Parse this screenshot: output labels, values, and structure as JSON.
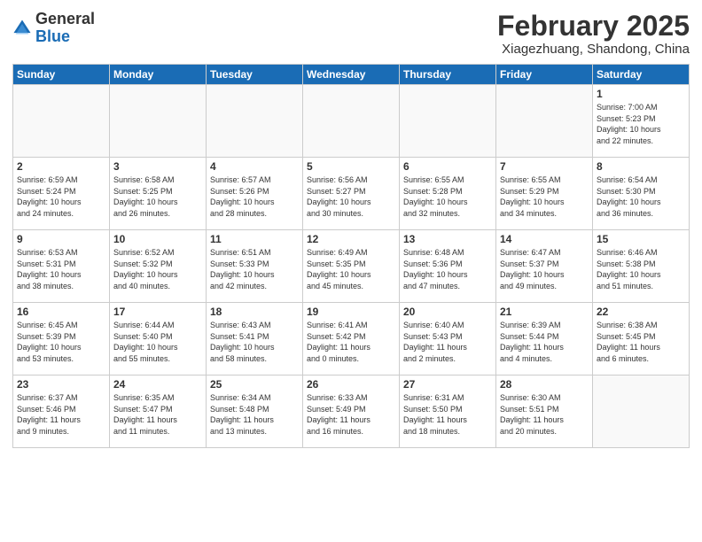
{
  "header": {
    "logo_general": "General",
    "logo_blue": "Blue",
    "month_title": "February 2025",
    "subtitle": "Xiagezhuang, Shandong, China"
  },
  "days_of_week": [
    "Sunday",
    "Monday",
    "Tuesday",
    "Wednesday",
    "Thursday",
    "Friday",
    "Saturday"
  ],
  "weeks": [
    [
      {
        "day": "",
        "info": ""
      },
      {
        "day": "",
        "info": ""
      },
      {
        "day": "",
        "info": ""
      },
      {
        "day": "",
        "info": ""
      },
      {
        "day": "",
        "info": ""
      },
      {
        "day": "",
        "info": ""
      },
      {
        "day": "1",
        "info": "Sunrise: 7:00 AM\nSunset: 5:23 PM\nDaylight: 10 hours\nand 22 minutes."
      }
    ],
    [
      {
        "day": "2",
        "info": "Sunrise: 6:59 AM\nSunset: 5:24 PM\nDaylight: 10 hours\nand 24 minutes."
      },
      {
        "day": "3",
        "info": "Sunrise: 6:58 AM\nSunset: 5:25 PM\nDaylight: 10 hours\nand 26 minutes."
      },
      {
        "day": "4",
        "info": "Sunrise: 6:57 AM\nSunset: 5:26 PM\nDaylight: 10 hours\nand 28 minutes."
      },
      {
        "day": "5",
        "info": "Sunrise: 6:56 AM\nSunset: 5:27 PM\nDaylight: 10 hours\nand 30 minutes."
      },
      {
        "day": "6",
        "info": "Sunrise: 6:55 AM\nSunset: 5:28 PM\nDaylight: 10 hours\nand 32 minutes."
      },
      {
        "day": "7",
        "info": "Sunrise: 6:55 AM\nSunset: 5:29 PM\nDaylight: 10 hours\nand 34 minutes."
      },
      {
        "day": "8",
        "info": "Sunrise: 6:54 AM\nSunset: 5:30 PM\nDaylight: 10 hours\nand 36 minutes."
      }
    ],
    [
      {
        "day": "9",
        "info": "Sunrise: 6:53 AM\nSunset: 5:31 PM\nDaylight: 10 hours\nand 38 minutes."
      },
      {
        "day": "10",
        "info": "Sunrise: 6:52 AM\nSunset: 5:32 PM\nDaylight: 10 hours\nand 40 minutes."
      },
      {
        "day": "11",
        "info": "Sunrise: 6:51 AM\nSunset: 5:33 PM\nDaylight: 10 hours\nand 42 minutes."
      },
      {
        "day": "12",
        "info": "Sunrise: 6:49 AM\nSunset: 5:35 PM\nDaylight: 10 hours\nand 45 minutes."
      },
      {
        "day": "13",
        "info": "Sunrise: 6:48 AM\nSunset: 5:36 PM\nDaylight: 10 hours\nand 47 minutes."
      },
      {
        "day": "14",
        "info": "Sunrise: 6:47 AM\nSunset: 5:37 PM\nDaylight: 10 hours\nand 49 minutes."
      },
      {
        "day": "15",
        "info": "Sunrise: 6:46 AM\nSunset: 5:38 PM\nDaylight: 10 hours\nand 51 minutes."
      }
    ],
    [
      {
        "day": "16",
        "info": "Sunrise: 6:45 AM\nSunset: 5:39 PM\nDaylight: 10 hours\nand 53 minutes."
      },
      {
        "day": "17",
        "info": "Sunrise: 6:44 AM\nSunset: 5:40 PM\nDaylight: 10 hours\nand 55 minutes."
      },
      {
        "day": "18",
        "info": "Sunrise: 6:43 AM\nSunset: 5:41 PM\nDaylight: 10 hours\nand 58 minutes."
      },
      {
        "day": "19",
        "info": "Sunrise: 6:41 AM\nSunset: 5:42 PM\nDaylight: 11 hours\nand 0 minutes."
      },
      {
        "day": "20",
        "info": "Sunrise: 6:40 AM\nSunset: 5:43 PM\nDaylight: 11 hours\nand 2 minutes."
      },
      {
        "day": "21",
        "info": "Sunrise: 6:39 AM\nSunset: 5:44 PM\nDaylight: 11 hours\nand 4 minutes."
      },
      {
        "day": "22",
        "info": "Sunrise: 6:38 AM\nSunset: 5:45 PM\nDaylight: 11 hours\nand 6 minutes."
      }
    ],
    [
      {
        "day": "23",
        "info": "Sunrise: 6:37 AM\nSunset: 5:46 PM\nDaylight: 11 hours\nand 9 minutes."
      },
      {
        "day": "24",
        "info": "Sunrise: 6:35 AM\nSunset: 5:47 PM\nDaylight: 11 hours\nand 11 minutes."
      },
      {
        "day": "25",
        "info": "Sunrise: 6:34 AM\nSunset: 5:48 PM\nDaylight: 11 hours\nand 13 minutes."
      },
      {
        "day": "26",
        "info": "Sunrise: 6:33 AM\nSunset: 5:49 PM\nDaylight: 11 hours\nand 16 minutes."
      },
      {
        "day": "27",
        "info": "Sunrise: 6:31 AM\nSunset: 5:50 PM\nDaylight: 11 hours\nand 18 minutes."
      },
      {
        "day": "28",
        "info": "Sunrise: 6:30 AM\nSunset: 5:51 PM\nDaylight: 11 hours\nand 20 minutes."
      },
      {
        "day": "",
        "info": ""
      }
    ]
  ]
}
